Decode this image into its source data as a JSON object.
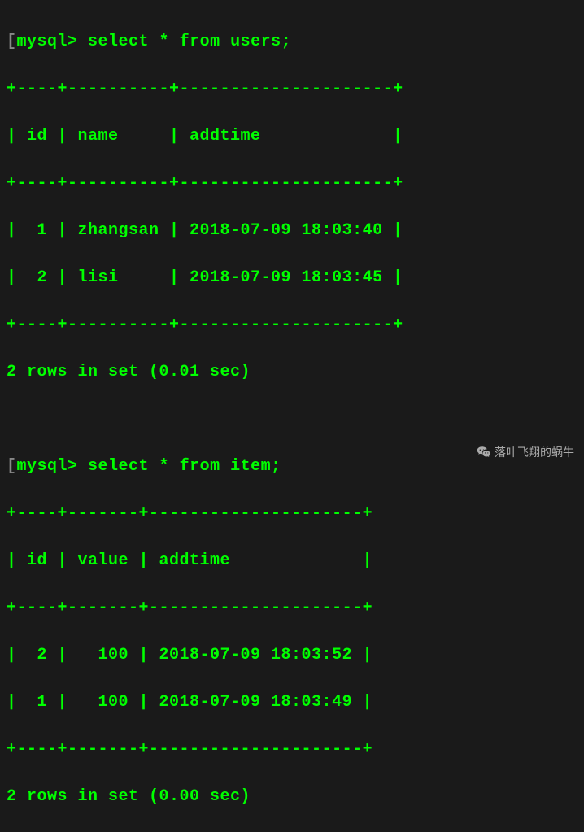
{
  "prompt": "mysql>",
  "bracket": "[",
  "query1": {
    "command": "select * from users;",
    "border_top": "+----+----------+---------------------+",
    "header": "| id | name     | addtime             |",
    "row1": "|  1 | zhangsan | 2018-07-09 18:03:40 |",
    "row2": "|  2 | lisi     | 2018-07-09 18:03:45 |",
    "result": "2 rows in set (0.01 sec)"
  },
  "query2": {
    "command": "select * from item;",
    "border_top": "+----+-------+---------------------+",
    "header": "| id | value | addtime             |",
    "row1": "|  2 |   100 | 2018-07-09 18:03:52 |",
    "row2": "|  1 |   100 | 2018-07-09 18:03:49 |",
    "result": "2 rows in set (0.00 sec)"
  },
  "watermark_text": "落叶飞翔的蜗牛"
}
